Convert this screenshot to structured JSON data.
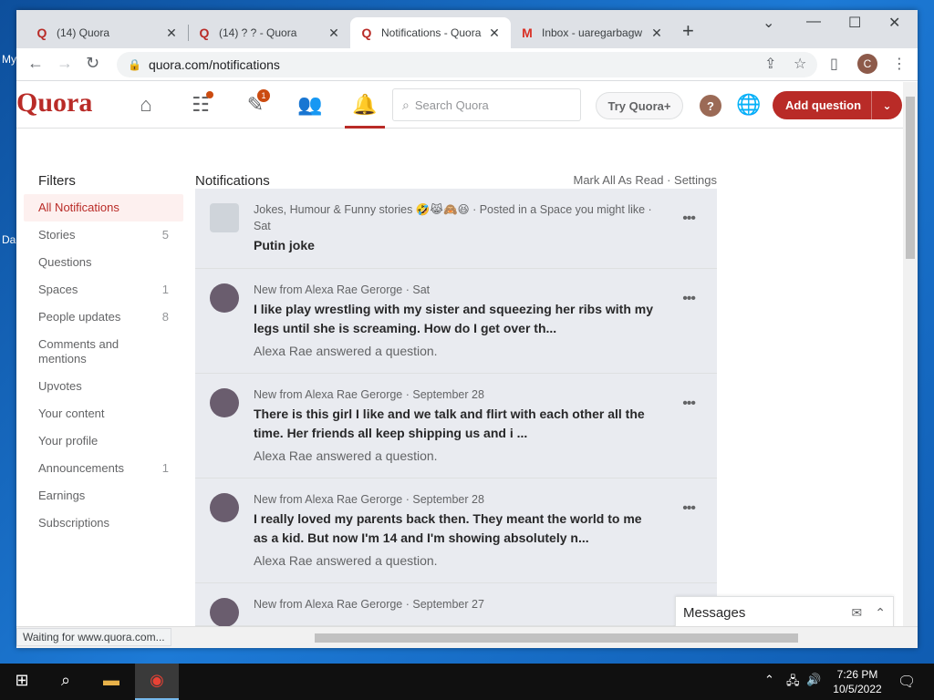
{
  "desktop": {
    "labels": [
      "My",
      "Da"
    ]
  },
  "browser": {
    "tabs": [
      {
        "title": "(14) Quora",
        "favicon": "quora-color-icon",
        "active": false
      },
      {
        "title": "(14) ? ? - Quora",
        "favicon": "quora-color-icon",
        "active": false
      },
      {
        "title": "Notifications - Quora",
        "favicon": "quora-icon",
        "active": true
      },
      {
        "title": "Inbox - uaregarbagw",
        "favicon": "gmail-icon",
        "active": false
      }
    ],
    "url": "quora.com/notifications",
    "profile_initial": "C",
    "status_text": "Waiting for www.quora.com..."
  },
  "quora": {
    "logo": "Quora",
    "header": {
      "search_placeholder": "Search Quora",
      "try_plus": "Try Quora+",
      "help_glyph": "?",
      "add_question": "Add question",
      "badges": {
        "answer": "1"
      }
    },
    "filters": {
      "title": "Filters",
      "items": [
        {
          "label": "All Notifications",
          "count": "",
          "active": true
        },
        {
          "label": "Stories",
          "count": "5"
        },
        {
          "label": "Questions",
          "count": ""
        },
        {
          "label": "Spaces",
          "count": "1"
        },
        {
          "label": "People updates",
          "count": "8"
        },
        {
          "label": "Comments and mentions",
          "count": ""
        },
        {
          "label": "Upvotes",
          "count": ""
        },
        {
          "label": "Your content",
          "count": ""
        },
        {
          "label": "Your profile",
          "count": ""
        },
        {
          "label": "Announcements",
          "count": "1"
        },
        {
          "label": "Earnings",
          "count": ""
        },
        {
          "label": "Subscriptions",
          "count": ""
        }
      ]
    },
    "notifications": {
      "title": "Notifications",
      "links": "Mark All As Read · Settings",
      "items": [
        {
          "meta": "Jokes, Humour & Funny stories 🤣😹🙈😆 · Posted in a Space you might like · Sat",
          "question": "Putin joke",
          "sub": ""
        },
        {
          "meta": "New from Alexa Rae Gerorge · Sat",
          "question": "I like play wrestling with my sister and squeezing her ribs with my legs until she is screaming. How do I get over th...",
          "sub": "Alexa Rae answered a question."
        },
        {
          "meta": "New from Alexa Rae Gerorge · September 28",
          "question": "There is this girl I like and we talk and flirt with each other all the time. Her friends all keep shipping us and i ...",
          "sub": "Alexa Rae answered a question."
        },
        {
          "meta": "New from Alexa Rae Gerorge · September 28",
          "question": "I really loved my parents back then. They meant the world to me as a kid. But now I'm 14 and I'm showing absolutely n...",
          "sub": "Alexa Rae answered a question."
        },
        {
          "meta": "New from Alexa Rae Gerorge · September 27",
          "question": "",
          "sub": ""
        }
      ],
      "more_glyph": "•••"
    },
    "messages": {
      "label": "Messages"
    }
  },
  "taskbar": {
    "time": "7:26 PM",
    "date": "10/5/2022"
  },
  "colors": {
    "quora_red": "#b92b27",
    "notification_bg": "#e9ebf0",
    "active_filter_bg": "#fdf0ef"
  }
}
